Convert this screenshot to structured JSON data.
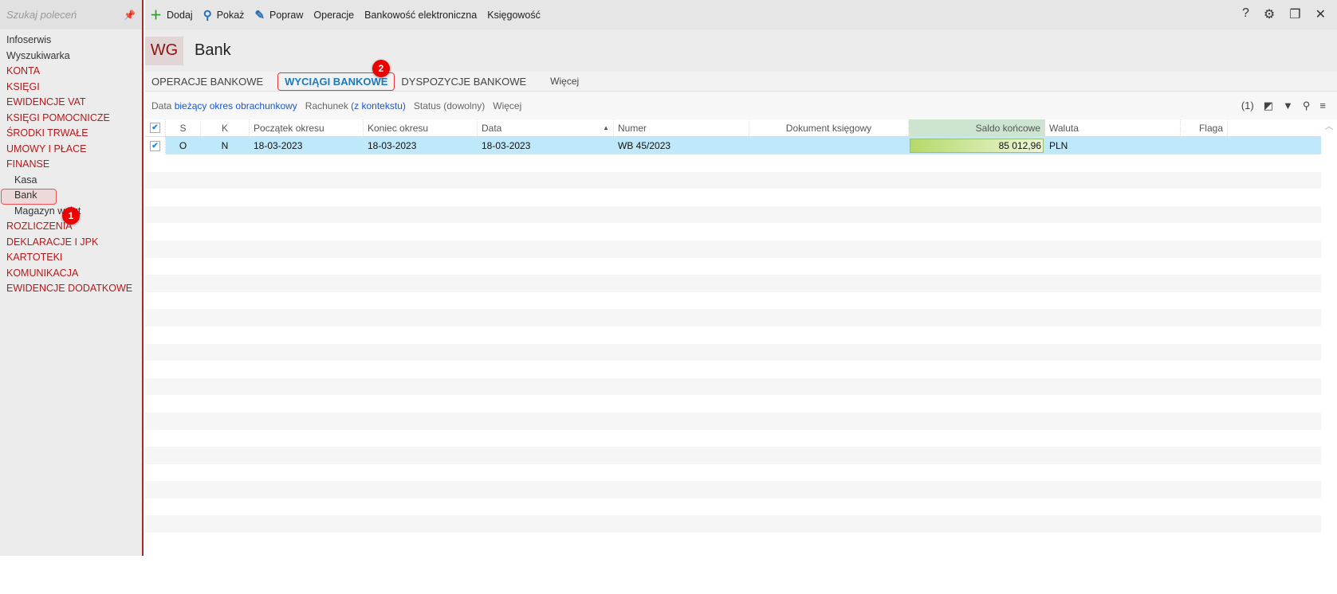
{
  "sidebar": {
    "search_placeholder": "Szukaj poleceń",
    "items": [
      {
        "label": "Infoserwis",
        "kind": "plain"
      },
      {
        "label": "Wyszukiwarka",
        "kind": "plain"
      },
      {
        "label": "KONTA",
        "kind": "sec"
      },
      {
        "label": "KSIĘGI",
        "kind": "sec"
      },
      {
        "label": "EWIDENCJE VAT",
        "kind": "sec"
      },
      {
        "label": "KSIĘGI POMOCNICZE",
        "kind": "sec"
      },
      {
        "label": "ŚRODKI TRWAŁE",
        "kind": "sec"
      },
      {
        "label": "UMOWY I PŁACE",
        "kind": "sec"
      },
      {
        "label": "FINANSE",
        "kind": "sec"
      },
      {
        "label": "Kasa",
        "kind": "sub"
      },
      {
        "label": "Bank",
        "kind": "sub active"
      },
      {
        "label": "Magazyn walut",
        "kind": "sub"
      },
      {
        "label": "ROZLICZENIA",
        "kind": "sec"
      },
      {
        "label": "DEKLARACJE I JPK",
        "kind": "sec"
      },
      {
        "label": "KARTOTEKI",
        "kind": "sec"
      },
      {
        "label": "KOMUNIKACJA",
        "kind": "sec"
      },
      {
        "label": "EWIDENCJE DODATKOWE",
        "kind": "sec"
      }
    ]
  },
  "badges": {
    "one": "1",
    "two": "2"
  },
  "toolbar": {
    "add": "Dodaj",
    "show": "Pokaż",
    "edit": "Popraw",
    "operations": "Operacje",
    "ebanking": "Bankowość elektroniczna",
    "accounting": "Księgowość"
  },
  "window": {
    "help": "?",
    "settings": "⚙",
    "restore": "❐",
    "close": "✕"
  },
  "header": {
    "code": "WG",
    "title": "Bank"
  },
  "tabs": [
    "OPERACJE BANKOWE",
    "WYCIĄGI BANKOWE",
    "DYSPOZYCJE BANKOWE",
    "Więcej"
  ],
  "filters": {
    "data_label": "Data",
    "data_value": "bieżący okres obrachunkowy",
    "account_label": "Rachunek",
    "account_value": "(z kontekstu)",
    "status": "Status (dowolny)",
    "more": "Więcej",
    "count": "(1)"
  },
  "columns": [
    "S",
    "K",
    "Początek okresu",
    "Koniec okresu",
    "Data",
    "Numer",
    "Dokument księgowy",
    "Saldo końcowe",
    "Waluta",
    "Flaga"
  ],
  "rows": [
    {
      "s": "O",
      "k": "N",
      "start": "18-03-2023",
      "end": "18-03-2023",
      "date": "18-03-2023",
      "number": "WB 45/2023",
      "document": "",
      "balance": "85 012,96",
      "currency": "PLN",
      "flag": ""
    }
  ]
}
